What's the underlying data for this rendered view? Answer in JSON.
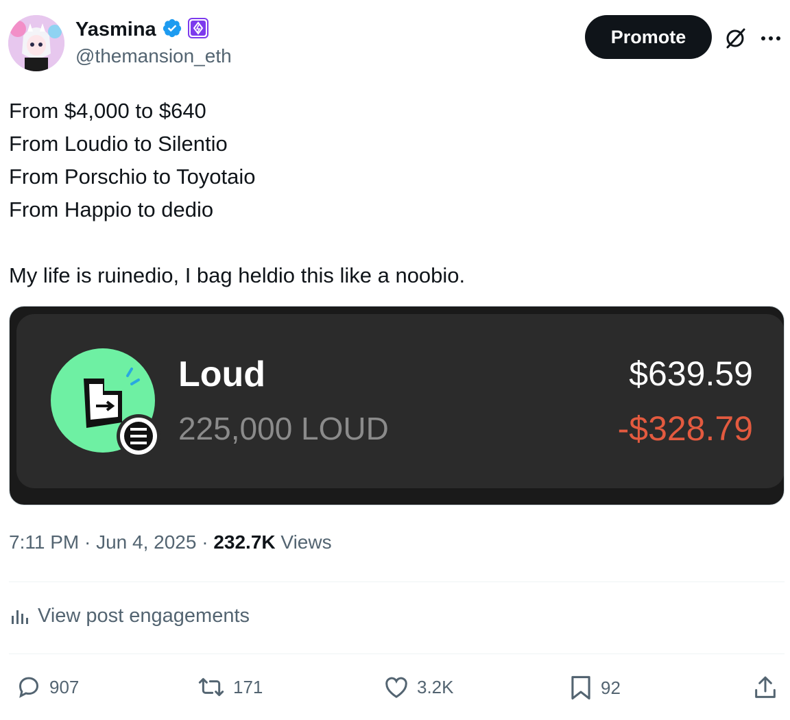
{
  "author": {
    "name": "Yasmina",
    "handle": "@themansion_eth"
  },
  "header_actions": {
    "promote_label": "Promote"
  },
  "tweet": {
    "lines": [
      "From $4,000 to $640",
      "From Loudio to Silentio",
      "From Porschio to Toyotaio",
      "From Happio to dedio"
    ],
    "closing": "My life is ruinedio, I bag heldio this like a noobio."
  },
  "media_card": {
    "token_name": "Loud",
    "token_amount": "225,000 LOUD",
    "token_value": "$639.59",
    "token_pnl": "-$328.79",
    "pnl_color": "#e35a3f",
    "icon_color": "#6ef0a3"
  },
  "meta": {
    "time": "7:11 PM",
    "sep1": " · ",
    "date": "Jun 4, 2025",
    "sep2": " · ",
    "views_count": "232.7K",
    "views_label": " Views"
  },
  "engagements_label": "View post engagements",
  "actions": {
    "replies": "907",
    "reposts": "171",
    "likes": "3.2K",
    "bookmarks": "92"
  },
  "colors": {
    "verified": "#1d9bf0",
    "affiliate_badge": "#7c3aed",
    "secondary_text": "#536471"
  }
}
